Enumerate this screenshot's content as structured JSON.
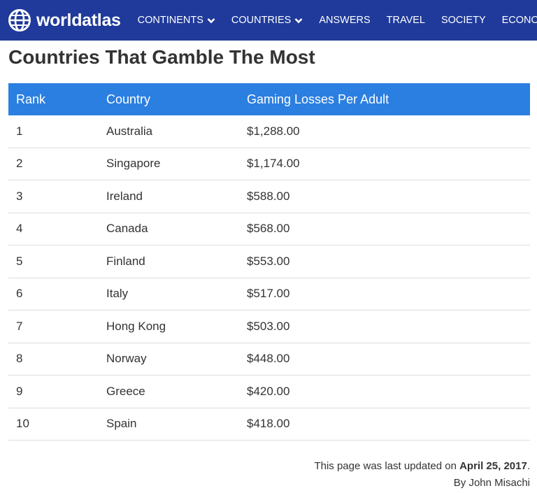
{
  "nav": {
    "logo_text": "worldatlas",
    "items": [
      {
        "label": "CONTINENTS",
        "dropdown": true
      },
      {
        "label": "COUNTRIES",
        "dropdown": true
      },
      {
        "label": "ANSWERS",
        "dropdown": false
      },
      {
        "label": "TRAVEL",
        "dropdown": false
      },
      {
        "label": "SOCIETY",
        "dropdown": false
      },
      {
        "label": "ECONOMICS",
        "dropdown": false
      }
    ]
  },
  "page": {
    "title": "Countries That Gamble The Most"
  },
  "table": {
    "headers": [
      "Rank",
      "Country",
      "Gaming Losses Per Adult"
    ],
    "rows": [
      [
        "1",
        "Australia",
        "$1,288.00"
      ],
      [
        "2",
        "Singapore",
        "$1,174.00"
      ],
      [
        "3",
        "Ireland",
        "$588.00"
      ],
      [
        "4",
        "Canada",
        "$568.00"
      ],
      [
        "5",
        "Finland",
        "$553.00"
      ],
      [
        "6",
        "Italy",
        "$517.00"
      ],
      [
        "7",
        "Hong Kong",
        "$503.00"
      ],
      [
        "8",
        "Norway",
        "$448.00"
      ],
      [
        "9",
        "Greece",
        "$420.00"
      ],
      [
        "10",
        "Spain",
        "$418.00"
      ]
    ]
  },
  "footer": {
    "updated_prefix": "This page was last updated on ",
    "updated_date": "April 25, 2017",
    "updated_suffix": ".",
    "byline": "By John Misachi"
  },
  "colors": {
    "nav_bg": "#1f3a9a",
    "table_header_bg": "#2b7fe0"
  }
}
